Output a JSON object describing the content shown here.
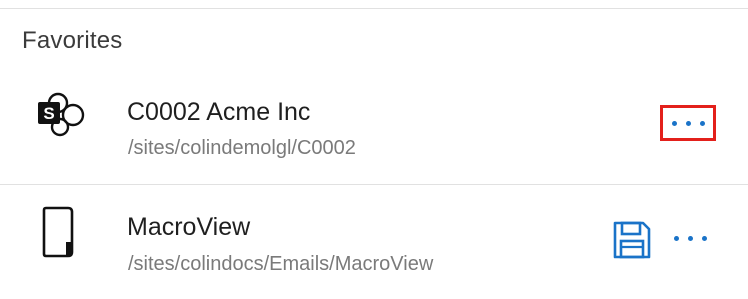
{
  "favorites": {
    "header": "Favorites",
    "items": [
      {
        "title": "C0002 Acme Inc",
        "path": "/sites/colindemolgl/C0002",
        "icon": "sharepoint-site-icon"
      },
      {
        "title": "MacroView",
        "path": "/sites/colindocs/Emails/MacroView",
        "icon": "document-library-icon",
        "action_icon": "save-icon"
      }
    ]
  },
  "colors": {
    "accent": "#1a73c8",
    "highlight_box": "#e3201b",
    "title_text": "#1f1f1f",
    "path_text": "#7a7a7a",
    "divider": "#e1e1e1"
  }
}
